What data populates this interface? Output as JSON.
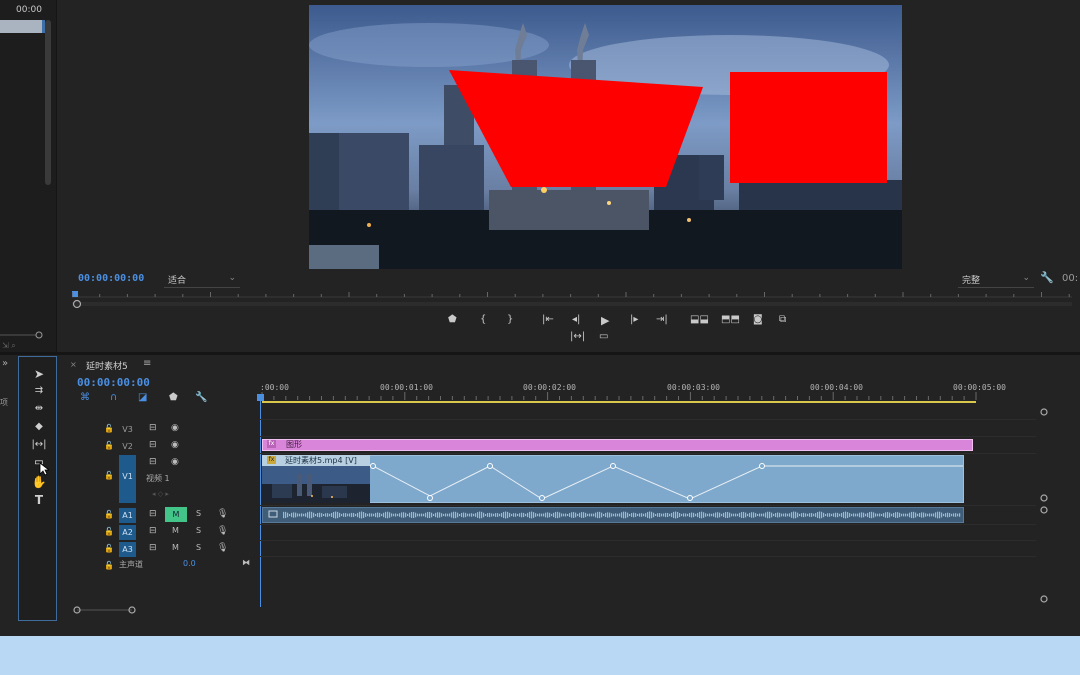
{
  "left_panel": {
    "timecode": "00:00",
    "edge_char": "项"
  },
  "monitor": {
    "timecode": "00:00:00:00",
    "fit_select": "适合",
    "quality_select": "完整",
    "timecode_right": "00:",
    "transport_icons": [
      "marker-icon",
      "mark-in-icon",
      "mark-out-icon",
      "go-to-in-icon",
      "step-back-icon",
      "play-icon",
      "step-forward-icon",
      "go-to-out-icon",
      "lift-icon",
      "extract-icon",
      "export-frame-icon",
      "comparison-view-icon"
    ],
    "transport_row2": [
      "trim-icon",
      "safe-margins-icon"
    ]
  },
  "timeline": {
    "tab_close": "×",
    "sequence_name": "延时素材5",
    "menu_glyph": "≡",
    "timecode": "00:00:00:00",
    "ruler_labels": [
      ":00:00",
      "00:00:01:00",
      "00:00:02:00",
      "00:00:03:00",
      "00:00:04:00",
      "00:00:05:00"
    ],
    "tracks": {
      "video": [
        {
          "name": "V3",
          "active": false
        },
        {
          "name": "V2",
          "active": false
        },
        {
          "name": "V1",
          "active": true,
          "label": "视频 1"
        }
      ],
      "audio": [
        {
          "name": "A1",
          "active": true,
          "mute": "M",
          "solo": "S"
        },
        {
          "name": "A2",
          "active": true,
          "mute": "M",
          "solo": "S"
        },
        {
          "name": "A3",
          "active": true,
          "mute": "M",
          "solo": "S"
        }
      ],
      "master": {
        "name": "主声道",
        "value": "0.0"
      }
    },
    "clips": {
      "graphic": {
        "name": "图形",
        "icon": "fx"
      },
      "video": {
        "name": "延时素材5.mp4 [V]",
        "icon": "fx"
      }
    }
  },
  "colors": {
    "accent": "#4a8fe2",
    "graphic_clip": "#d985d9",
    "video_clip": "#7ea9cc",
    "mask_red": "#ff0000",
    "work_area": "#d9c64c",
    "mute_active": "#43c58a"
  }
}
